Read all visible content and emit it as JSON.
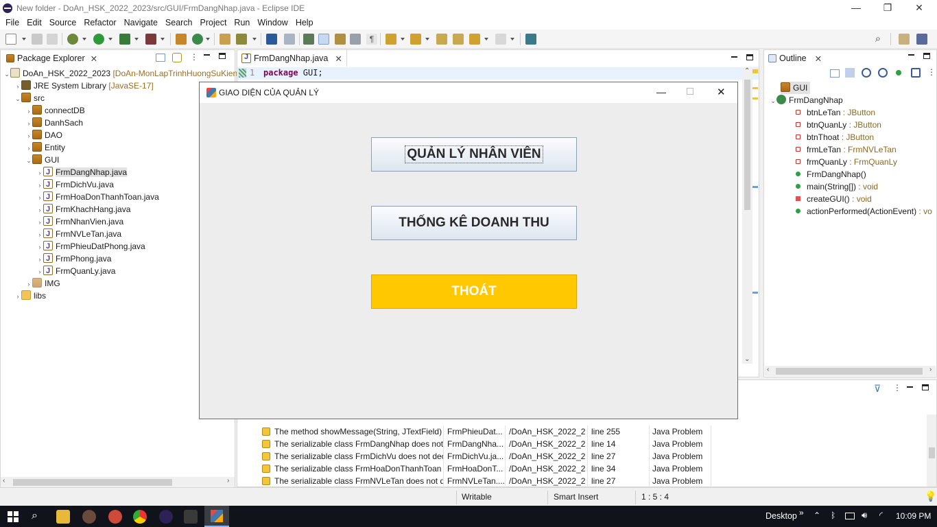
{
  "window": {
    "title": "New folder - DoAn_HSK_2022_2023/src/GUI/FrmDangNhap.java - Eclipse IDE",
    "min": "—",
    "max": "❐",
    "close": "✕"
  },
  "menu": [
    "File",
    "Edit",
    "Source",
    "Refactor",
    "Navigate",
    "Search",
    "Project",
    "Run",
    "Window",
    "Help"
  ],
  "package_explorer": {
    "tab": "Package Explorer",
    "project": "DoAn_HSK_2022_2023",
    "project_suffix": "[DoAn-MonLapTrinhHuongSuKien",
    "jre": "JRE System Library",
    "jre_suffix": "[JavaSE-17]",
    "src": "src",
    "packages": [
      "connectDB",
      "DanhSach",
      "DAO",
      "Entity",
      "GUI"
    ],
    "files": [
      "FrmDangNhap.java",
      "FrmDichVu.java",
      "FrmHoaDonThanhToan.java",
      "FrmKhachHang.java",
      "FrmNhanVien.java",
      "FrmNVLeTan.java",
      "FrmPhieuDatPhong.java",
      "FrmPhong.java",
      "FrmQuanLy.java"
    ],
    "img": "IMG",
    "libs": "libs"
  },
  "editor": {
    "tab": "FrmDangNhap.java",
    "line_no": "1",
    "keyword": "package",
    "code": " GUI;"
  },
  "outline": {
    "tab": "Outline",
    "package": "GUI",
    "class": "FrmDangNhap",
    "members": [
      {
        "name": "btnLeTan",
        "type": " : JButton",
        "kind": "field"
      },
      {
        "name": "btnQuanLy",
        "type": " : JButton",
        "kind": "field"
      },
      {
        "name": "btnThoat",
        "type": " : JButton",
        "kind": "field"
      },
      {
        "name": "frmLeTan",
        "type": " : FrmNVLeTan",
        "kind": "field"
      },
      {
        "name": "frmQuanLy",
        "type": " : FrmQuanLy",
        "kind": "field"
      },
      {
        "name": "FrmDangNhap()",
        "type": "",
        "kind": "ctor"
      },
      {
        "name": "main(String[])",
        "type": " : void",
        "kind": "static"
      },
      {
        "name": "createGUI()",
        "type": " : void",
        "kind": "private"
      },
      {
        "name": "actionPerformed(ActionEvent)",
        "type": " : vo",
        "kind": "method"
      }
    ]
  },
  "dialog": {
    "title": "GIAO DIỆN CỦA QUẢN LÝ",
    "btn_staff": "QUẢN LÝ NHÂN VIÊN",
    "btn_revenue": "THỐNG KÊ DOANH THU",
    "btn_exit": "THOÁT",
    "exit_color": "#ffc800"
  },
  "problems": [
    {
      "desc": "The method showMessage(String, JTextField) f",
      "res": "FrmPhieuDat...",
      "path": "/DoAn_HSK_2022_2...",
      "loc": "line 255",
      "type": "Java Problem"
    },
    {
      "desc": "The serializable class FrmDangNhap does not d",
      "res": "FrmDangNha...",
      "path": "/DoAn_HSK_2022_2...",
      "loc": "line 14",
      "type": "Java Problem"
    },
    {
      "desc": "The serializable class FrmDichVu does not decl",
      "res": "FrmDichVu.ja...",
      "path": "/DoAn_HSK_2022_2...",
      "loc": "line 27",
      "type": "Java Problem"
    },
    {
      "desc": "The serializable class FrmHoaDonThanhToan c",
      "res": "FrmHoaDonT...",
      "path": "/DoAn_HSK_2022_2...",
      "loc": "line 34",
      "type": "Java Problem"
    },
    {
      "desc": "The serializable class FrmNVLeTan does not de",
      "res": "FrmNVLeTan....",
      "path": "/DoAn_HSK_2022_2...",
      "loc": "line 27",
      "type": "Java Problem"
    }
  ],
  "status": {
    "writable": "Writable",
    "insert": "Smart Insert",
    "pos": "1 : 5 : 4"
  },
  "taskbar": {
    "desktop": "Desktop",
    "chevron": "»",
    "time": "10:09 PM"
  }
}
